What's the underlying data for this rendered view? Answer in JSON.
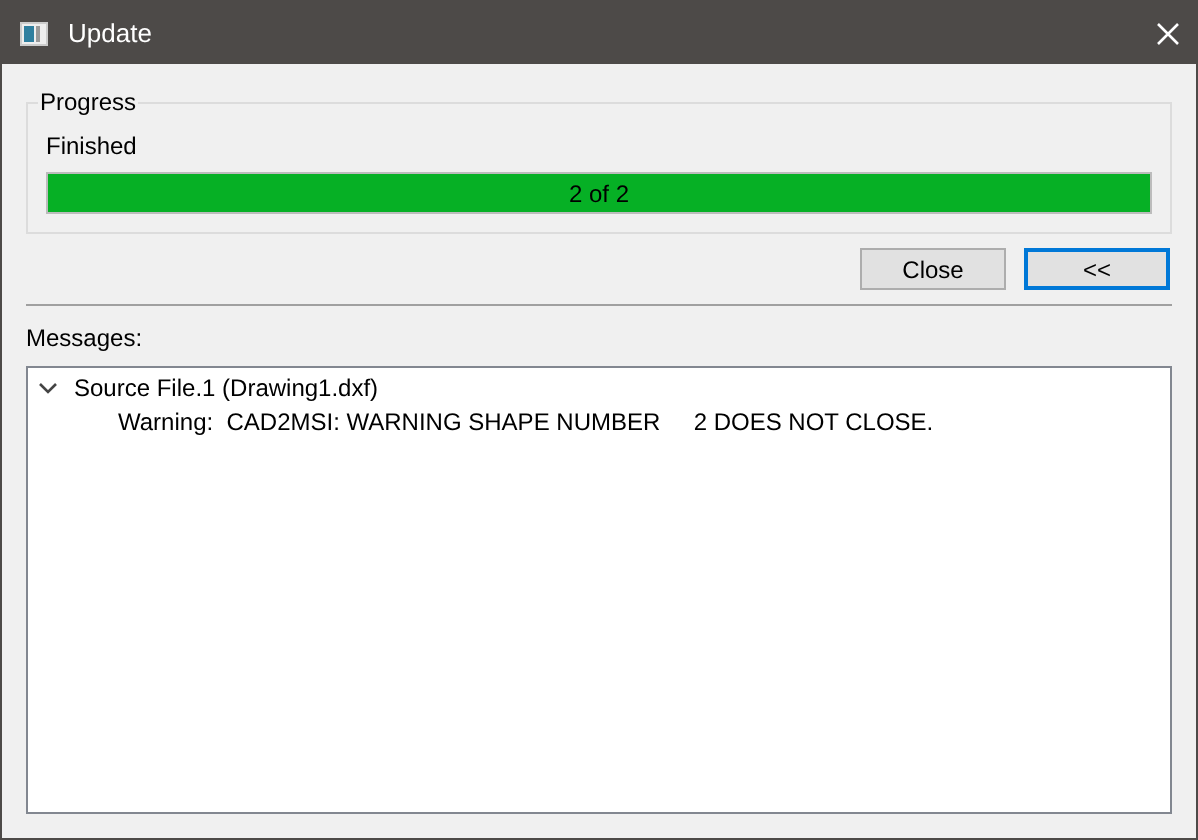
{
  "window": {
    "title": "Update"
  },
  "progress": {
    "group_label": "Progress",
    "status": "Finished",
    "level": 1,
    "reading": "2 of 2"
  },
  "buttons": [
    {
      "label": "Close",
      "default": false
    },
    {
      "label": "<<",
      "default": true
    }
  ],
  "messages": {
    "label": "Messages:",
    "items": [
      {
        "text": "Source File.1 (Drawing1.dxf)",
        "expanded": true,
        "children": [
          {
            "text": "Warning:  CAD2MSI: WARNING SHAPE NUMBER     2 DOES NOT CLOSE."
          }
        ]
      }
    ]
  }
}
